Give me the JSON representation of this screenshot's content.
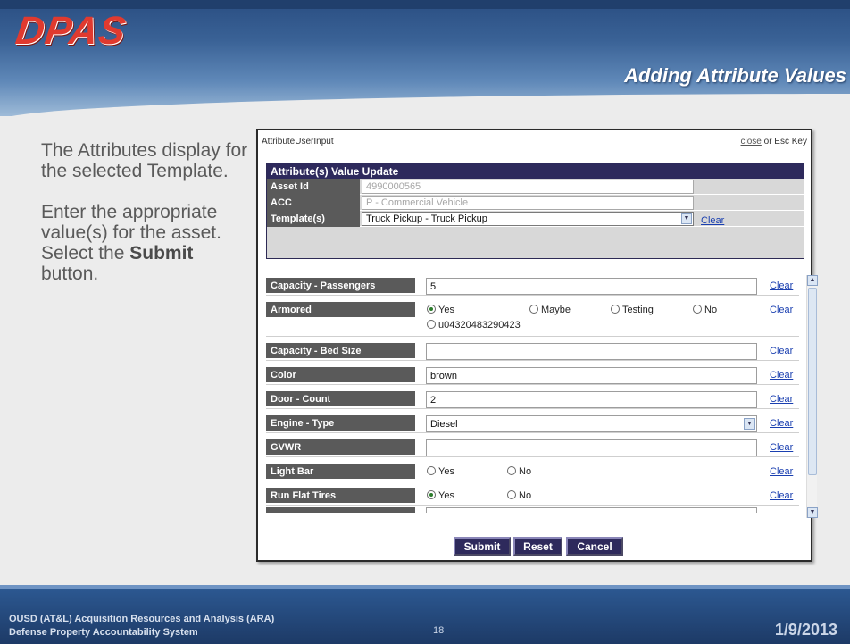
{
  "header": {
    "logo": "DPAS",
    "title": "Adding Attribute Values"
  },
  "instructions": {
    "para1": "The Attributes display for the selected Template.",
    "para2_pre": "Enter the appropriate value(s) for the asset. Select the ",
    "para2_bold": "Submit",
    "para2_post": " button."
  },
  "dialog": {
    "title": "AttributeUserInput",
    "close_link": "close",
    "close_suffix": " or Esc Key",
    "section_title": "Attribute(s) Value Update",
    "fields": [
      {
        "label": "Asset Id",
        "value": "4990000565"
      },
      {
        "label": "ACC",
        "value": "P - Commercial Vehicle"
      },
      {
        "label": "Template(s)",
        "value": "Truck Pickup - Truck Pickup",
        "clear": "Clear"
      }
    ],
    "attributes": [
      {
        "label": "Capacity - Passengers",
        "value": "5",
        "clear": "Clear"
      },
      {
        "label": "Armored",
        "options": [
          "Yes",
          "Maybe",
          "Testing",
          "No",
          "u04320483290423"
        ],
        "selected": "Yes",
        "clear": "Clear"
      },
      {
        "label": "Capacity - Bed Size",
        "value": "",
        "clear": "Clear"
      },
      {
        "label": "Color",
        "value": "brown",
        "clear": "Clear"
      },
      {
        "label": "Door - Count",
        "value": "2",
        "clear": "Clear"
      },
      {
        "label": "Engine - Type",
        "value": "Diesel",
        "clear": "Clear"
      },
      {
        "label": "GVWR",
        "value": "",
        "clear": "Clear"
      },
      {
        "label": "Light Bar",
        "options": [
          "Yes",
          "No"
        ],
        "selected": "",
        "clear": "Clear"
      },
      {
        "label": "Run Flat Tires",
        "options": [
          "Yes",
          "No"
        ],
        "selected": "Yes",
        "clear": "Clear"
      }
    ],
    "buttons": {
      "submit": "Submit",
      "reset": "Reset",
      "cancel": "Cancel"
    }
  },
  "footer": {
    "line1": "OUSD (AT&L) Acquisition Resources and Analysis (ARA)",
    "line2": "Defense Property Accountability System",
    "page": "18",
    "date": "1/9/2013"
  },
  "colors": {
    "header_blue": "#3a6296",
    "dialog_head": "#2e2a5c",
    "label_gray": "#5a5a5a",
    "link_blue": "#1a3fb0",
    "logo_red": "#e03a2f"
  }
}
